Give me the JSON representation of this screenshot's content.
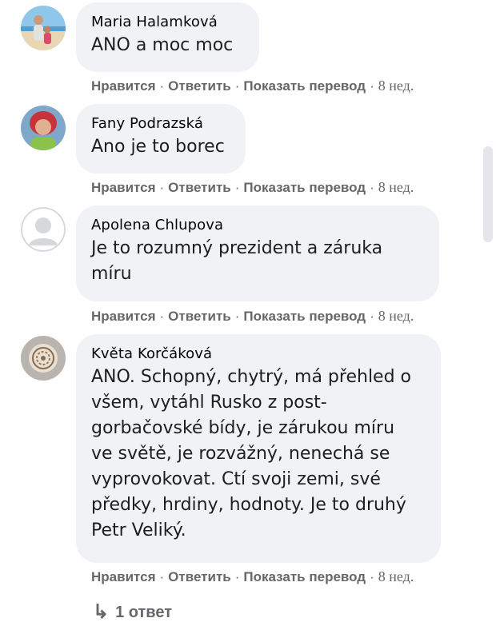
{
  "comments": [
    {
      "author": "Maria Halamková",
      "text": "ANO a moc moc",
      "avatar_icon": "user-photo-beach-icon",
      "actions": {
        "like": "Нравится",
        "reply": "Ответить",
        "translate": "Показать перевод",
        "time": "8 нед."
      }
    },
    {
      "author": "Fany Podrazská",
      "text": "Ano je to borec",
      "avatar_icon": "user-photo-red-hair-icon",
      "actions": {
        "like": "Нравится",
        "reply": "Ответить",
        "translate": "Показать перевод",
        "time": "8 нед."
      }
    },
    {
      "author": "Apolena Chlupova",
      "text": "Je to rozumný prezident a záruka\nmíru",
      "avatar_icon": "default-avatar-icon",
      "actions": {
        "like": "Нравится",
        "reply": "Ответить",
        "translate": "Показать перевод",
        "time": "8 нед."
      }
    },
    {
      "author": "Květa Korčáková",
      "text": "ANO. Schopný, chytrý, má přehled o\nvšem, vytáhl Rusko z post-\ngorbačovské bídy, je zárukou míru\nve světě, je rozvážný, nenechá se\nvyprovokovat. Ctí svoji zemi, své\npředky, hrdiny, hodnoty. Je to druhý\nPetr Veliký.",
      "avatar_icon": "user-photo-ornament-icon",
      "actions": {
        "like": "Нравится",
        "reply": "Ответить",
        "translate": "Показать перевод",
        "time": "8 нед."
      }
    }
  ],
  "separator": "·",
  "replies": {
    "arrow": "↳",
    "label": "1 ответ"
  },
  "colors": {
    "bubble": "#f0f2f5",
    "meta_text": "#65676b",
    "author_text": "#050505"
  }
}
